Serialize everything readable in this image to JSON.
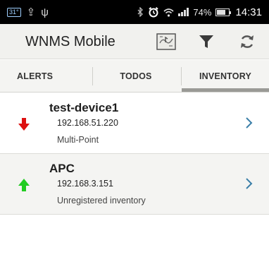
{
  "status_bar": {
    "calendar_day": "31°",
    "upload_icon": "upload-icon",
    "usb_icon": "usb-icon",
    "battery_percent": "74%",
    "battery_level": 0.74,
    "time": "14:31"
  },
  "action_bar": {
    "title": "WNMS Mobile",
    "map_icon": "map-icon",
    "filter_icon": "filter-icon",
    "refresh_icon": "refresh-icon"
  },
  "tabs": [
    {
      "label": "ALERTS",
      "selected": false
    },
    {
      "label": "TODOS",
      "selected": false
    },
    {
      "label": "INVENTORY",
      "selected": true
    }
  ],
  "inventory": [
    {
      "name": "test-device1",
      "ip": "192.168.51.220",
      "description": "Multi-Point",
      "status_icon": "arrow-down-icon",
      "status_color": "#dd1111"
    },
    {
      "name": "APC",
      "ip": "192.168.3.151",
      "description": "Unregistered inventory",
      "status_icon": "arrow-up-icon",
      "status_color": "#22cc22"
    }
  ],
  "colors": {
    "accent_chevron": "#3b7fa8",
    "tab_indicator": "#9a9a96"
  }
}
